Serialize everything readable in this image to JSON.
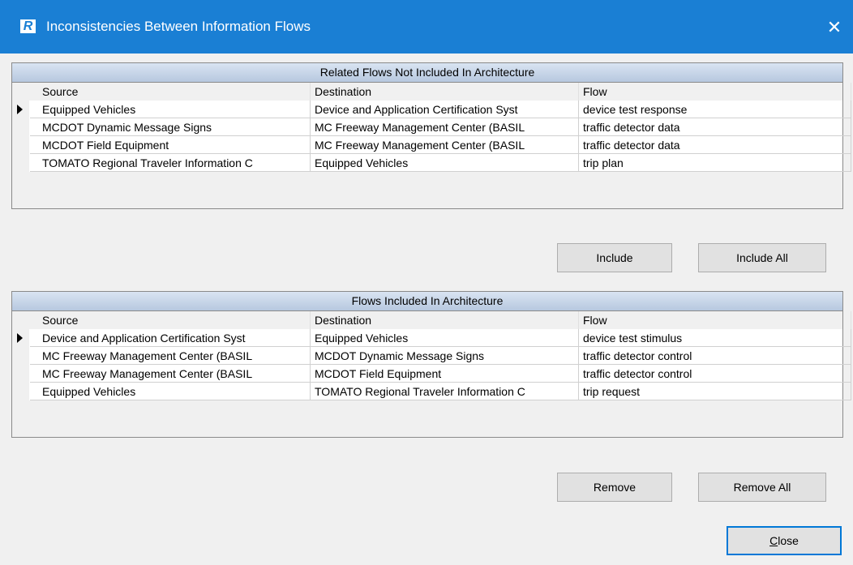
{
  "window": {
    "title": "Inconsistencies Between Information Flows",
    "icon_letter": "R",
    "close_glyph": "✕"
  },
  "related_flows": {
    "caption": "Related Flows Not Included In Architecture",
    "columns": [
      "Source",
      "Destination",
      "Flow"
    ],
    "rows": [
      [
        "Equipped Vehicles",
        "Device and Application Certification Syst",
        "device test response"
      ],
      [
        "MCDOT Dynamic Message Signs",
        "MC Freeway Management Center (BASIL",
        "traffic detector data"
      ],
      [
        "MCDOT Field Equipment",
        "MC Freeway Management Center (BASIL",
        "traffic detector data"
      ],
      [
        "TOMATO Regional Traveler Information C",
        "Equipped Vehicles",
        "trip plan"
      ]
    ]
  },
  "included_flows": {
    "caption": "Flows Included In Architecture",
    "columns": [
      "Source",
      "Destination",
      "Flow"
    ],
    "rows": [
      [
        "Device and Application Certification Syst",
        "Equipped Vehicles",
        "device test stimulus"
      ],
      [
        "MC Freeway Management Center (BASIL",
        "MCDOT Dynamic Message Signs",
        "traffic detector control"
      ],
      [
        "MC Freeway Management Center (BASIL",
        "MCDOT Field Equipment",
        "traffic detector control"
      ],
      [
        "Equipped Vehicles",
        "TOMATO Regional Traveler Information C",
        "trip request"
      ]
    ]
  },
  "buttons": {
    "include": "Include",
    "include_all": "Include All",
    "remove": "Remove",
    "remove_all": "Remove All",
    "close_mnemonic": "C",
    "close_rest": "lose"
  }
}
